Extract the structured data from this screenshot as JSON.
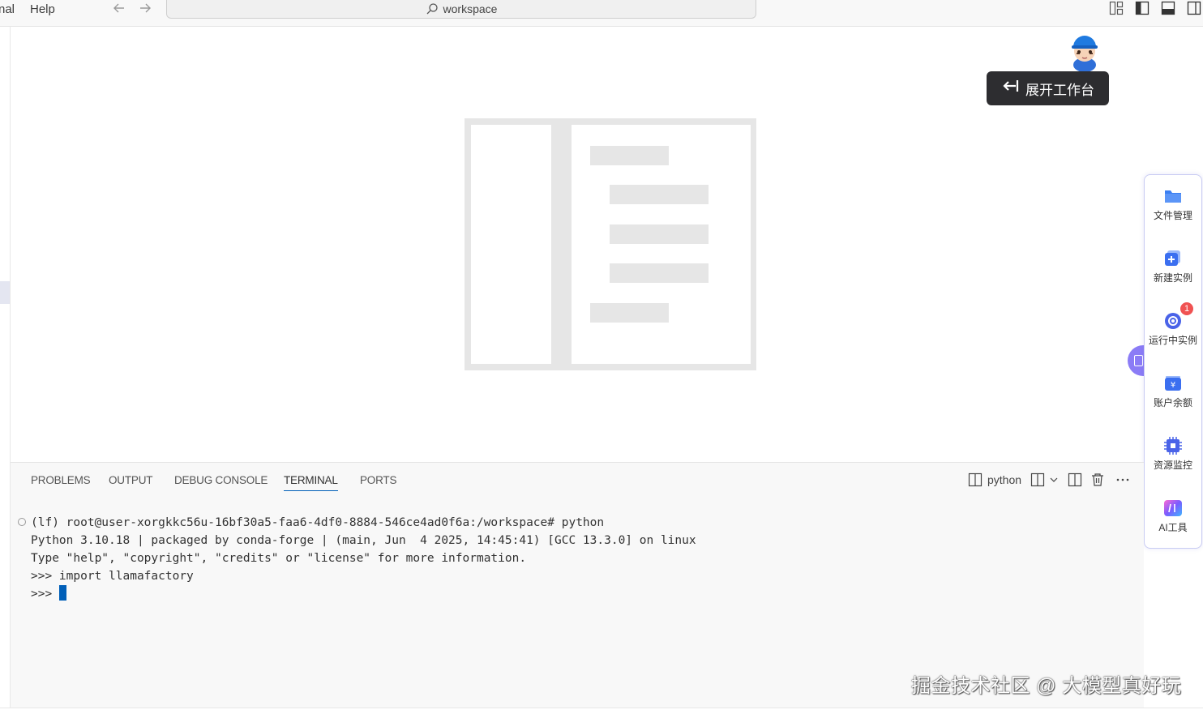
{
  "titlebar": {
    "menu_partial": "nal",
    "menu_help": "Help",
    "back_icon": "arrow-left-icon",
    "forward_icon": "arrow-right-icon",
    "search_text": "workspace"
  },
  "workbench": {
    "label": "展开工作台"
  },
  "side_toolbar": {
    "items": [
      {
        "label": "文件管理",
        "icon": "folder-icon"
      },
      {
        "label": "新建实例",
        "icon": "new-instance-icon"
      },
      {
        "label": "运行中实例",
        "icon": "running-instance-icon",
        "badge": "1"
      },
      {
        "label": "账户余额",
        "icon": "wallet-icon"
      },
      {
        "label": "资源监控",
        "icon": "chip-icon"
      },
      {
        "label": "AI工具",
        "icon": "ai-tool-icon"
      }
    ]
  },
  "panel": {
    "tabs": [
      "PROBLEMS",
      "OUTPUT",
      "DEBUG CONSOLE",
      "TERMINAL",
      "PORTS"
    ],
    "active_tab": "TERMINAL",
    "terminal_name": "python"
  },
  "terminal": {
    "lines": [
      "(lf) root@user-xorgkkc56u-16bf30a5-faa6-4df0-8884-546ce4ad0f6a:/workspace# python",
      "Python 3.10.18 | packaged by conda-forge | (main, Jun  4 2025, 14:45:41) [GCC 13.3.0] on linux",
      "Type \"help\", \"copyright\", \"credits\" or \"license\" for more information.",
      ">>> import llamafactory"
    ],
    "prompt": ">>> "
  },
  "watermark": "掘金技术社区 @ 大模型真好玩",
  "colors": {
    "accent": "#005fb8",
    "toolbar_border": "#c9ccf3",
    "badge": "#f05252",
    "tooltip_bg": "#2d2d30"
  }
}
